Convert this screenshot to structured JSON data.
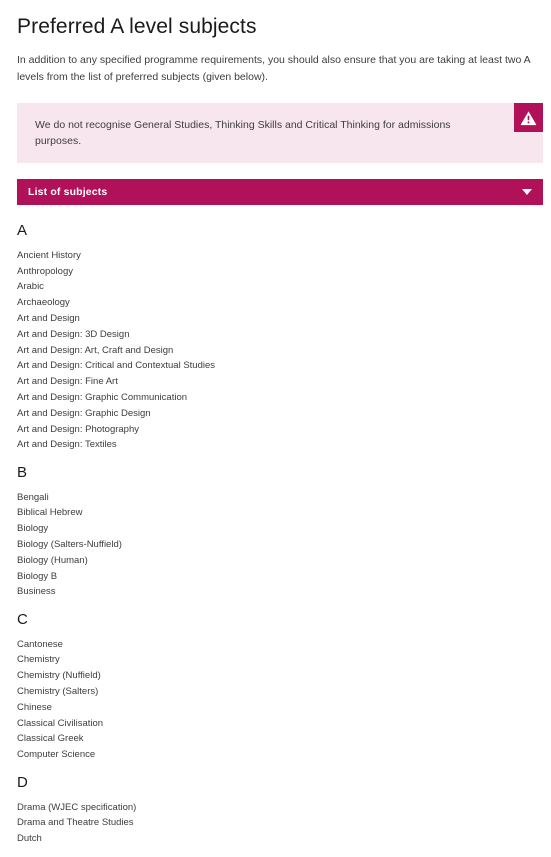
{
  "page": {
    "title": "Preferred A level subjects",
    "intro": "In addition to any specified programme requirements, you should also ensure that you are taking at least two A levels from the list of preferred subjects (given below)."
  },
  "warning": {
    "text": "We do not recognise General Studies, Thinking Skills and Critical Thinking for admissions purposes.",
    "icon": "warning-triangle-icon",
    "icon_bg_color": "#b01159",
    "banner_bg_color": "#f8e6ee"
  },
  "accordion": {
    "label": "List of subjects",
    "caret_icon": "chevron-down-icon",
    "bar_color": "#b01159",
    "expanded": true
  },
  "groups": [
    {
      "letter": "A",
      "subjects": [
        "Ancient History",
        "Anthropology",
        "Arabic",
        "Archaeology",
        "Art and Design",
        "Art and Design: 3D Design",
        "Art and Design: Art, Craft and Design",
        "Art and Design: Critical and Contextual Studies",
        "Art and Design: Fine Art",
        "Art and Design: Graphic Communication",
        "Art and Design: Graphic Design",
        "Art and Design: Photography",
        "Art and Design: Textiles"
      ]
    },
    {
      "letter": "B",
      "subjects": [
        "Bengali",
        "Biblical Hebrew",
        "Biology",
        "Biology (Salters-Nuffield)",
        "Biology (Human)",
        "Biology B",
        "Business"
      ]
    },
    {
      "letter": "C",
      "subjects": [
        "Cantonese",
        "Chemistry",
        "Chemistry (Nuffield)",
        "Chemistry (Salters)",
        "Chinese",
        "Classical Civilisation",
        "Classical Greek",
        "Computer Science"
      ]
    },
    {
      "letter": "D",
      "subjects": [
        "Drama (WJEC specification)",
        "Drama and Theatre Studies",
        "Dutch"
      ]
    }
  ]
}
